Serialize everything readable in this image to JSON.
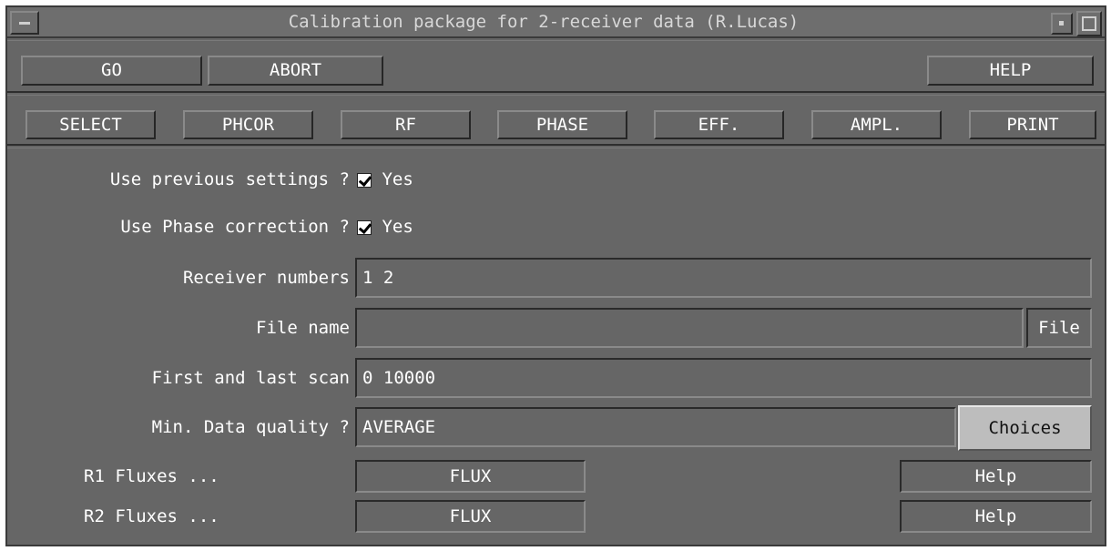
{
  "window": {
    "title": "Calibration package for 2-receiver data (R.Lucas)"
  },
  "toolbar_top": {
    "go": "GO",
    "abort": "ABORT",
    "help": "HELP"
  },
  "toolbar_sections": [
    "SELECT",
    "PHCOR",
    "RF",
    "PHASE",
    "EFF.",
    "AMPL.",
    "PRINT"
  ],
  "form": {
    "use_previous_label": "Use previous settings ?",
    "use_previous_value": "Yes",
    "use_phase_label": "Use Phase correction ?",
    "use_phase_value": "Yes",
    "receiver_label": "Receiver numbers",
    "receiver_value": "1 2",
    "file_label": "File name",
    "file_value": "",
    "file_button": "File",
    "scan_label": "First and last scan",
    "scan_value": "0 10000",
    "quality_label": "Min. Data quality ?",
    "quality_value": "AVERAGE",
    "quality_button": "Choices",
    "r1_label": "R1 Fluxes ...",
    "r1_button": "FLUX",
    "r1_help": "Help",
    "r2_label": "R2 Fluxes ...",
    "r2_button": "FLUX",
    "r2_help": "Help"
  },
  "colors": {
    "background": "#666666",
    "choices_button": "#bdbdbd"
  }
}
